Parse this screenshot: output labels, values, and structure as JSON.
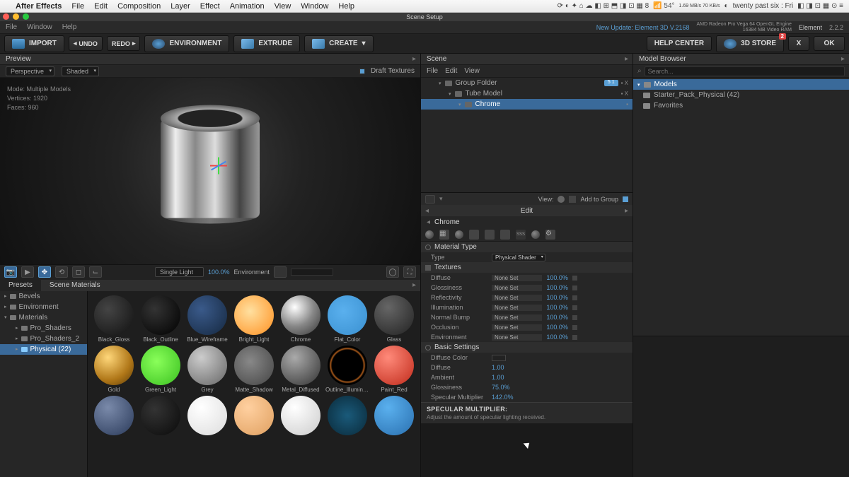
{
  "mac_menu": {
    "app": "After Effects",
    "items": [
      "File",
      "Edit",
      "Composition",
      "Layer",
      "Effect",
      "Animation",
      "View",
      "Window",
      "Help"
    ],
    "right_icons": "⟳ ◐ ✦ ⌂ ☁ ◧ ⊞ ⬒ ◨ ⊡ ▦ 8",
    "temp": "54°",
    "clock": "twenty past six : Fri",
    "bw": "1.69 MB/s 70 KB/s",
    "tray": "◧ ◨ ⊡ ▦ ⊙ ≡"
  },
  "window": {
    "title": "Scene Setup"
  },
  "submenu": {
    "items": [
      "File",
      "Window",
      "Help"
    ],
    "update": "New Update: Element 3D V.2168",
    "gpu": "AMD Radeon Pro Vega 64 OpenGL Engine",
    "vram": "16384 MB Video RAM",
    "brand": "Element",
    "ver": "2.2.2"
  },
  "toolbar": {
    "import": "IMPORT",
    "undo": "UNDO",
    "redo": "REDO",
    "environment": "ENVIRONMENT",
    "extrude": "EXTRUDE",
    "create": "CREATE",
    "help": "HELP CENTER",
    "store": "3D STORE",
    "store_badge": "2",
    "close": "X",
    "ok": "OK"
  },
  "preview": {
    "title": "Preview",
    "persp": "Perspective",
    "shaded": "Shaded",
    "draft": "Draft Textures",
    "stats": {
      "mode": "Mode:  Multiple Models",
      "verts": "Vertices: 1920",
      "faces": "Faces: 960"
    },
    "vpbar": {
      "light": "Single Light",
      "light_pct": "100.0%",
      "env": "Environment"
    }
  },
  "presets": {
    "tab1": "Presets",
    "tab2": "Scene Materials",
    "tree": [
      {
        "lvl": "l1",
        "label": "Bevels"
      },
      {
        "lvl": "l1",
        "label": "Environment"
      },
      {
        "lvl": "l1",
        "label": "Materials",
        "open": true
      },
      {
        "lvl": "l2",
        "label": "Pro_Shaders"
      },
      {
        "lvl": "l2",
        "label": "Pro_Shaders_2"
      },
      {
        "lvl": "l2",
        "label": "Physical (22)",
        "sel": true
      }
    ],
    "materials": [
      {
        "name": "Black_Gloss",
        "bg": "radial-gradient(circle at 35% 35%,#444,#111)"
      },
      {
        "name": "Black_Outline",
        "bg": "radial-gradient(circle at 35% 35%,#333,#000)"
      },
      {
        "name": "Blue_Wireframe",
        "bg": "radial-gradient(circle at 35% 35%,#3a5a8a,#152840)"
      },
      {
        "name": "Bright_Light",
        "bg": "radial-gradient(circle at 40% 40%,#ffe0a0,#ff9020)"
      },
      {
        "name": "Chrome",
        "bg": "radial-gradient(circle at 35% 30%,#fff,#888 50%,#333)"
      },
      {
        "name": "Flat_Color",
        "bg": "radial-gradient(circle at 40% 40%,#5ab0ee,#3a90d0)"
      },
      {
        "name": "Glass",
        "bg": "radial-gradient(circle at 35% 30%,#666,#222)"
      },
      {
        "name": "Gold",
        "bg": "radial-gradient(circle at 35% 30%,#ffd77a,#b07718 60%,#5a3a08)"
      },
      {
        "name": "Green_Light",
        "bg": "radial-gradient(circle at 40% 40%,#8aff5a,#3ac020)"
      },
      {
        "name": "Grey",
        "bg": "radial-gradient(circle at 35% 30%,#ccc,#666)"
      },
      {
        "name": "Matte_Shadow",
        "bg": "radial-gradient(circle at 40% 40%,#888,#444)"
      },
      {
        "name": "Metal_Diffused",
        "bg": "radial-gradient(circle at 35% 30%,#aaa,#333)"
      },
      {
        "name": "Outline_Illuminat...",
        "bg": "radial-gradient(circle at 50% 50%,#000 55%,#aa5a1a 60%,#000 65%)"
      },
      {
        "name": "Paint_Red",
        "bg": "radial-gradient(circle at 35% 30%,#ff8a7a,#c02a1a)"
      },
      {
        "name": "",
        "bg": "radial-gradient(circle at 35% 30%,#7a8aaa,#2a3a5a)"
      },
      {
        "name": "",
        "bg": "radial-gradient(circle at 35% 35%,#333,#0a0a0a)"
      },
      {
        "name": "",
        "bg": "radial-gradient(circle at 35% 30%,#fff,#ddd)"
      },
      {
        "name": "",
        "bg": "radial-gradient(circle at 35% 30%,#ffd0a0,#e0a060)"
      },
      {
        "name": "",
        "bg": "radial-gradient(circle at 35% 30%,#fff,#ccc)"
      },
      {
        "name": "",
        "bg": "radial-gradient(circle at 50% 50%,#1a5a7a,#0a2a3a)"
      },
      {
        "name": "",
        "bg": "radial-gradient(circle at 35% 30%,#5ab0ee,#2a70b0)"
      }
    ]
  },
  "scene": {
    "title": "Scene",
    "menus": [
      "File",
      "Edit",
      "View"
    ],
    "tree": [
      {
        "name": "Group Folder",
        "ind": "ind1",
        "badge": "5  1",
        "xtra": "▪ X"
      },
      {
        "name": "Tube Model",
        "ind": "ind2",
        "xtra": "▪ X"
      },
      {
        "name": "Chrome",
        "ind": "ind3",
        "sel": true,
        "xtra": "▪"
      }
    ],
    "foot": {
      "view": "View:",
      "add": "Add to Group"
    }
  },
  "edit": {
    "title": "Edit",
    "mat": "Chrome",
    "sections": {
      "material_type": "Material Type",
      "textures": "Textures",
      "basic": "Basic Settings"
    },
    "type_key": "Type",
    "type_val": "Physical Shader",
    "textures": [
      {
        "k": "Diffuse",
        "v": "None Set",
        "p": "100.0%"
      },
      {
        "k": "Glossiness",
        "v": "None Set",
        "p": "100.0%"
      },
      {
        "k": "Reflectivity",
        "v": "None Set",
        "p": "100.0%"
      },
      {
        "k": "Illumination",
        "v": "None Set",
        "p": "100.0%"
      },
      {
        "k": "Normal Bump",
        "v": "None Set",
        "p": "100.0%"
      },
      {
        "k": "Occlusion",
        "v": "None Set",
        "p": "100.0%"
      },
      {
        "k": "Environment",
        "v": "None Set",
        "p": "100.0%"
      }
    ],
    "basic": [
      {
        "k": "Diffuse Color",
        "swatch": true
      },
      {
        "k": "Diffuse",
        "v": "1.00"
      },
      {
        "k": "Ambient",
        "v": "1.00"
      },
      {
        "k": "Glossiness",
        "v": "75.0%"
      },
      {
        "k": "Specular Multiplier",
        "v": "142.0%"
      }
    ],
    "tooltip": {
      "title": "SPECULAR MULTIPLIER:",
      "body": "Adjust the amount of specular lighting received."
    }
  },
  "browser": {
    "title": "Model Browser",
    "search_ph": "Search...",
    "items": [
      {
        "label": "Models",
        "hdr": true
      },
      {
        "label": "Starter_Pack_Physical (42)"
      },
      {
        "label": "Favorites"
      }
    ]
  }
}
